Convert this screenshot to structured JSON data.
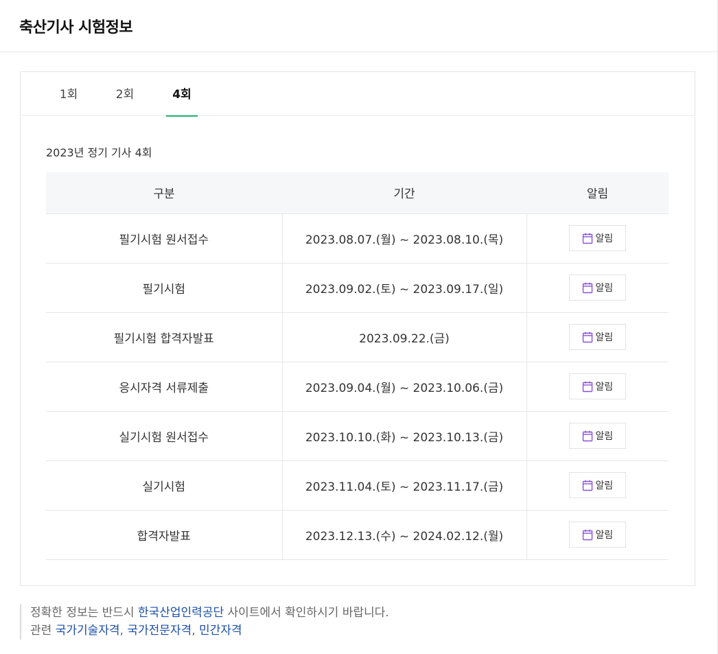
{
  "header": {
    "title": "축산기사 시험정보"
  },
  "tabs": [
    {
      "label": "1회",
      "active": false
    },
    {
      "label": "2회",
      "active": false
    },
    {
      "label": "4회",
      "active": true
    }
  ],
  "schedule": {
    "title": "2023년 정기 기사 4회",
    "columns": [
      "구분",
      "기간",
      "알림"
    ],
    "rows": [
      {
        "category": "필기시험 원서접수",
        "period": "2023.08.07.(월) ~ 2023.08.10.(목)",
        "alarm": "알림"
      },
      {
        "category": "필기시험",
        "period": "2023.09.02.(토) ~ 2023.09.17.(일)",
        "alarm": "알림"
      },
      {
        "category": "필기시험 합격자발표",
        "period": "2023.09.22.(금)",
        "alarm": "알림"
      },
      {
        "category": "응시자격 서류제출",
        "period": "2023.09.04.(월) ~ 2023.10.06.(금)",
        "alarm": "알림"
      },
      {
        "category": "실기시험 원서접수",
        "period": "2023.10.10.(화) ~ 2023.10.13.(금)",
        "alarm": "알림"
      },
      {
        "category": "실기시험",
        "period": "2023.11.04.(토) ~ 2023.11.17.(금)",
        "alarm": "알림"
      },
      {
        "category": "합격자발표",
        "period": "2023.12.13.(수) ~ 2024.02.12.(월)",
        "alarm": "알림"
      }
    ]
  },
  "notice": {
    "line1_prefix": "정확한 정보는 반드시",
    "line1_link": "한국산업인력공단",
    "line1_suffix": "사이트에서 확인하시기 바랍니다.",
    "line2_prefix": "관련",
    "links": [
      "국가기술자격",
      "국가전문자격",
      "민간자격"
    ]
  },
  "colors": {
    "active_tab_underline": "#19b26b",
    "calendar_icon": "#8a4fd8",
    "link": "#1a4fa8"
  },
  "icons": {
    "alarm": "calendar-icon"
  }
}
